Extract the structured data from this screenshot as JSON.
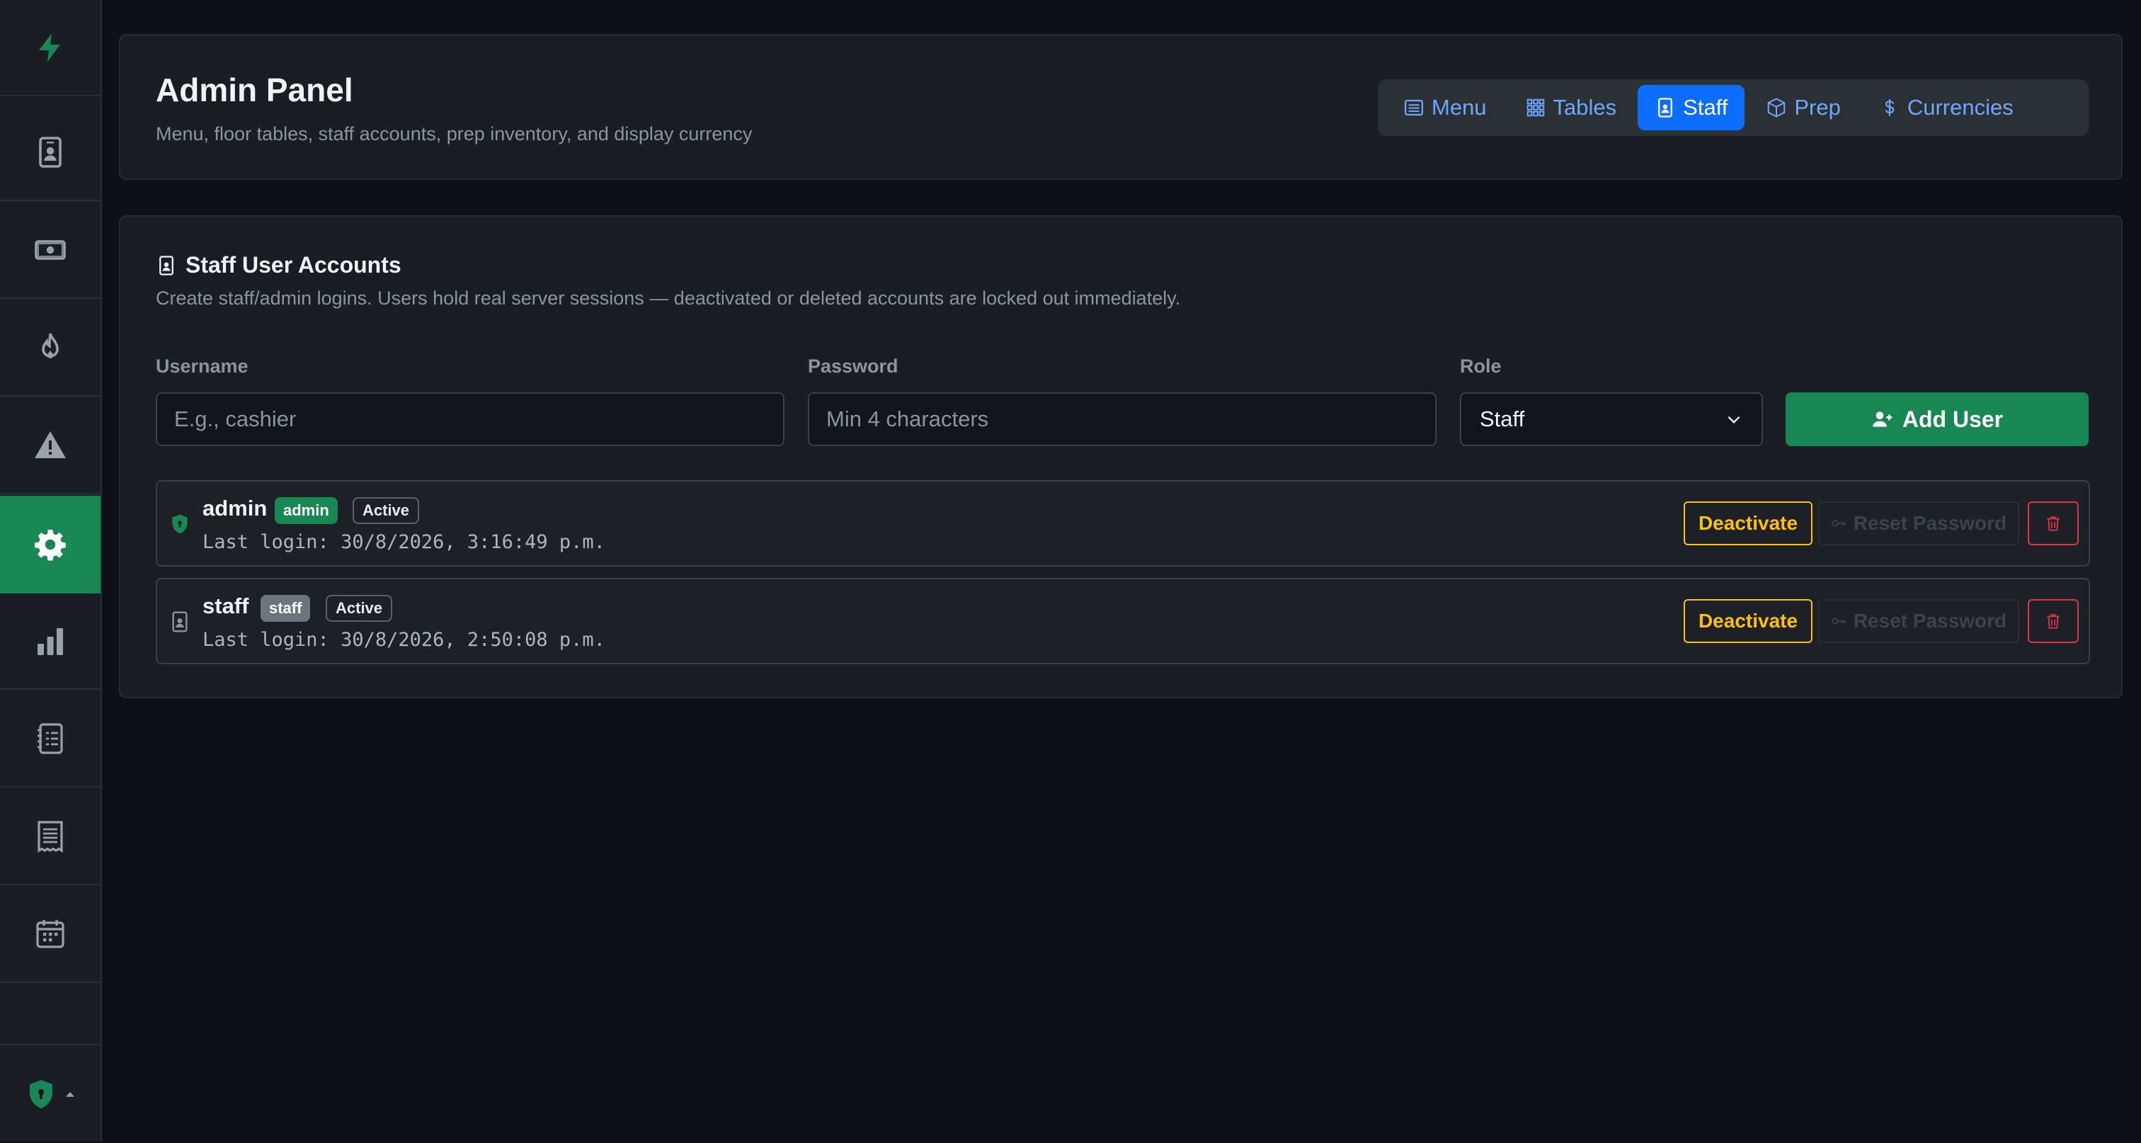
{
  "sidebar": {
    "items": [
      {
        "icon": "bolt-icon"
      },
      {
        "icon": "person-badge-icon"
      },
      {
        "icon": "cash-icon"
      },
      {
        "icon": "fire-icon"
      },
      {
        "icon": "warning-icon"
      },
      {
        "icon": "gear-icon",
        "active": true
      },
      {
        "icon": "bar-chart-icon"
      },
      {
        "icon": "journal-list-icon"
      },
      {
        "icon": "receipt-icon"
      },
      {
        "icon": "calendar-icon"
      }
    ],
    "bottom_icon": "shield-lock-icon"
  },
  "header": {
    "title": "Admin Panel",
    "subtitle": "Menu, floor tables, staff accounts, prep inventory, and display currency",
    "tabs": [
      {
        "label": "Menu",
        "icon": "list-icon"
      },
      {
        "label": "Tables",
        "icon": "grid-icon"
      },
      {
        "label": "Staff",
        "icon": "person-badge-icon",
        "active": true
      },
      {
        "label": "Prep",
        "icon": "box-icon"
      },
      {
        "label": "Currencies",
        "icon": "dollar-icon"
      }
    ]
  },
  "staff": {
    "title": "Staff User Accounts",
    "description": "Create staff/admin logins. Users hold real server sessions — deactivated or deleted accounts are locked out immediately.",
    "form": {
      "username_label": "Username",
      "username_placeholder": "E.g., cashier",
      "password_label": "Password",
      "password_placeholder": "Min 4 characters",
      "role_label": "Role",
      "role_value": "Staff",
      "add_label": "Add User"
    },
    "users": [
      {
        "name": "admin",
        "role": "admin",
        "status": "Active",
        "last_login": "Last login: 30/8/2026, 3:16:49 p.m.",
        "deactivate": "Deactivate",
        "reset": "Reset Password"
      },
      {
        "name": "staff",
        "role": "staff",
        "status": "Active",
        "last_login": "Last login: 30/8/2026, 2:50:08 p.m.",
        "deactivate": "Deactivate",
        "reset": "Reset Password"
      }
    ]
  },
  "colors": {
    "accent": "#198754",
    "tab_active": "#0d6efd",
    "tab_link": "#6ea8fe",
    "warning": "#ffc107",
    "danger": "#dc3545"
  }
}
